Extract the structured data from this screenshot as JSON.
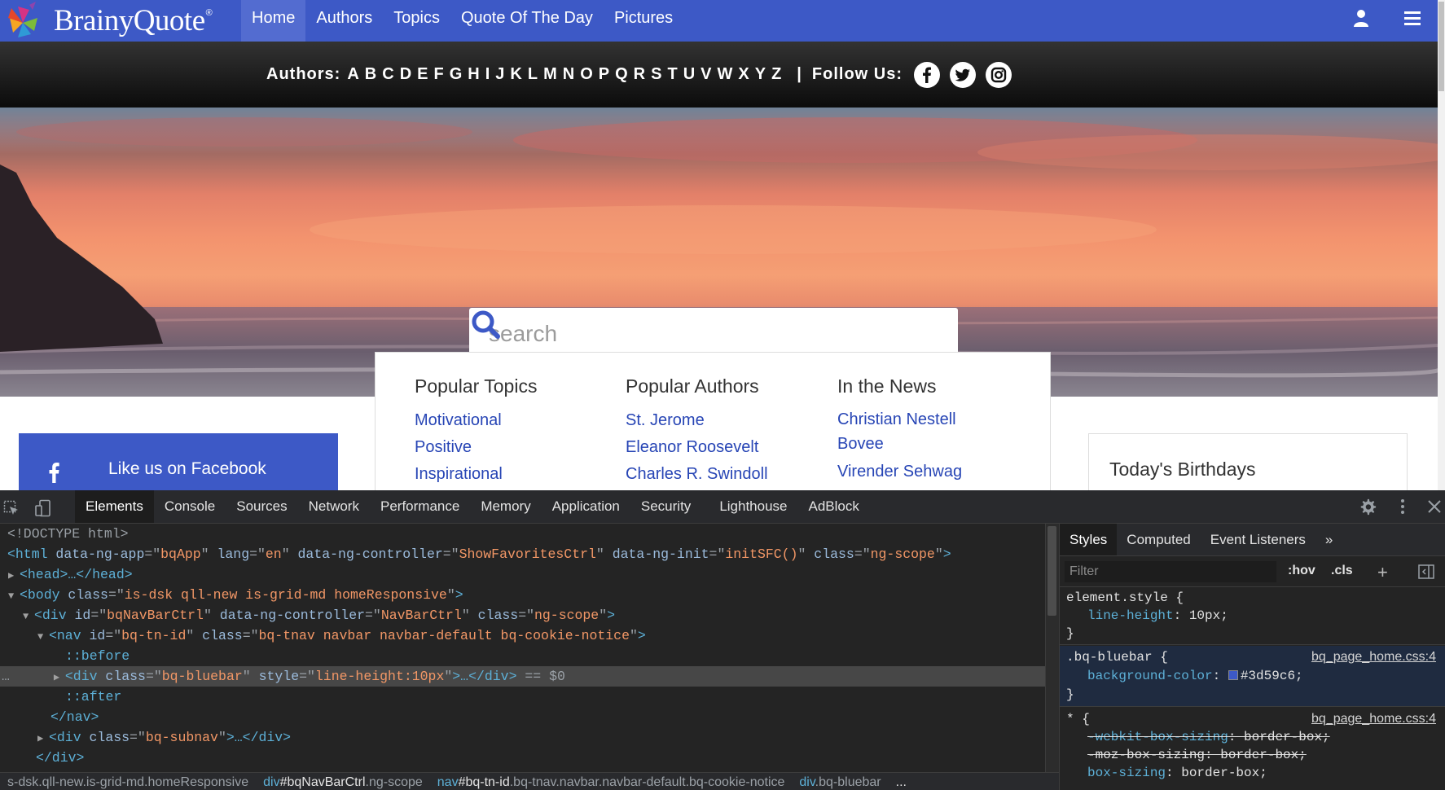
{
  "site": {
    "logo_text": "BrainyQuote",
    "logo_reg": "®",
    "nav_links": [
      "Home",
      "Authors",
      "Topics",
      "Quote Of The Day",
      "Pictures"
    ],
    "brand_color": "#3d59c6"
  },
  "subnav": {
    "authors_label": "Authors:",
    "letters": [
      "A",
      "B",
      "C",
      "D",
      "E",
      "F",
      "G",
      "H",
      "I",
      "J",
      "K",
      "L",
      "M",
      "N",
      "O",
      "P",
      "Q",
      "R",
      "S",
      "T",
      "U",
      "V",
      "W",
      "X",
      "Y",
      "Z"
    ],
    "separator": "|",
    "follow_label": "Follow Us:",
    "social_icons": [
      "facebook-icon",
      "twitter-icon",
      "instagram-icon"
    ]
  },
  "search": {
    "placeholder": "search"
  },
  "columns": [
    {
      "title": "Popular Topics",
      "links": [
        "Motivational",
        "Positive",
        "Inspirational"
      ]
    },
    {
      "title": "Popular Authors",
      "links": [
        "St. Jerome",
        "Eleanor Roosevelt",
        "Charles R. Swindoll"
      ]
    },
    {
      "title": "In the News",
      "links": [
        "Christian Nestell Bovee",
        "Virender Sehwag"
      ]
    }
  ],
  "facebook_like": "Like us on Facebook",
  "birthdays_title": "Today's Birthdays",
  "devtools": {
    "tabs": [
      "Elements",
      "Console",
      "Sources",
      "Network",
      "Performance",
      "Memory",
      "Application",
      "Security",
      "Lighthouse",
      "AdBlock"
    ],
    "active_tab": "Elements",
    "dom_lines": {
      "doctype": "<!DOCTYPE html>",
      "html_open": "<html data-ng-app=\"bqApp\" lang=\"en\" data-ng-controller=\"ShowFavoritesCtrl\" data-ng-init=\"initSFC()\" class=\"ng-scope\">",
      "head": "<head>…</head>",
      "body_open": "<body class=\"is-dsk qll-new is-grid-md homeResponsive\">",
      "div_navbar": "<div id=\"bqNavBarCtrl\" data-ng-controller=\"NavBarCtrl\" class=\"ng-scope\">",
      "nav_open": "<nav id=\"bq-tn-id\" class=\"bq-tnav navbar navbar-default bq-cookie-notice\">",
      "before": "::before",
      "div_bluebar": "<div class=\"bq-bluebar\" style=\"line-height:10px\">…</div>",
      "selected_marker": "== $0",
      "after": "::after",
      "nav_close": "</nav>",
      "div_subnav": "<div class=\"bq-subnav\">…</div>",
      "div_close": "</div>"
    },
    "breadcrumbs": [
      {
        "tag": "",
        "id": "",
        "cls": "s-dsk.qll-new.is-grid-md.homeResponsive"
      },
      {
        "tag": "div",
        "id": "#bqNavBarCtrl",
        "cls": ".ng-scope"
      },
      {
        "tag": "nav",
        "id": "#bq-tn-id",
        "cls": ".bq-tnav.navbar.navbar-default.bq-cookie-notice"
      },
      {
        "tag": "div",
        "id": "",
        "cls": ".bq-bluebar"
      }
    ],
    "breadcrumb_more": "...",
    "styles_tabs": [
      "Styles",
      "Computed",
      "Event Listeners"
    ],
    "styles_more": "»",
    "filter_placeholder": "Filter",
    "hov": ":hov",
    "cls": ".cls",
    "plus": "+",
    "rules": {
      "element_selector": "element.style {",
      "element_prop": "line-height",
      "element_val": "10px",
      "close": "}",
      "bluebar_selector": ".bq-bluebar {",
      "bluebar_src": "bq_page_home.css:4",
      "bluebar_prop": "background-color",
      "bluebar_val": "#3d59c6",
      "star_selector": "* {",
      "star_src": "bq_page_home.css:4",
      "star_props": [
        {
          "name": "-webkit-box-sizing",
          "val": "border-box",
          "struck": true
        },
        {
          "name": "-moz-box-sizing",
          "val": "border-box",
          "struck": true
        },
        {
          "name": "box-sizing",
          "val": "border-box",
          "struck": false
        }
      ]
    }
  }
}
